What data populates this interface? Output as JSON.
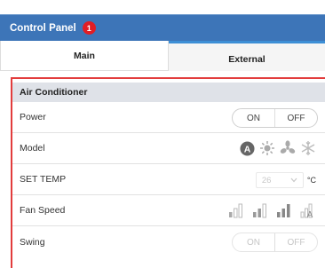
{
  "header": {
    "title": "Control Panel",
    "badge_count": "1"
  },
  "tabs": [
    {
      "label": "Main"
    },
    {
      "label": "External"
    }
  ],
  "section": {
    "title": "Air Conditioner"
  },
  "rows": {
    "power": {
      "label": "Power",
      "on": "ON",
      "off": "OFF"
    },
    "model": {
      "label": "Model",
      "icons": [
        "auto-mode-icon",
        "sun-heat-icon",
        "fan-mode-icon",
        "snowflake-cool-icon"
      ]
    },
    "set_temp": {
      "label": "SET TEMP",
      "value": "26",
      "unit": "°C"
    },
    "fan_speed": {
      "label": "Fan Speed",
      "icons": [
        "fan-low-icon",
        "fan-mid-icon",
        "fan-high-icon",
        "fan-auto-icon"
      ]
    },
    "swing": {
      "label": "Swing",
      "on": "ON",
      "off": "OFF"
    }
  },
  "colors": {
    "header_bg": "#3d75b8",
    "badge": "#e11d24",
    "active_tab_border": "#3d8fd6",
    "panel_border": "#e23c3c",
    "section_bg": "#dfe2e8"
  }
}
